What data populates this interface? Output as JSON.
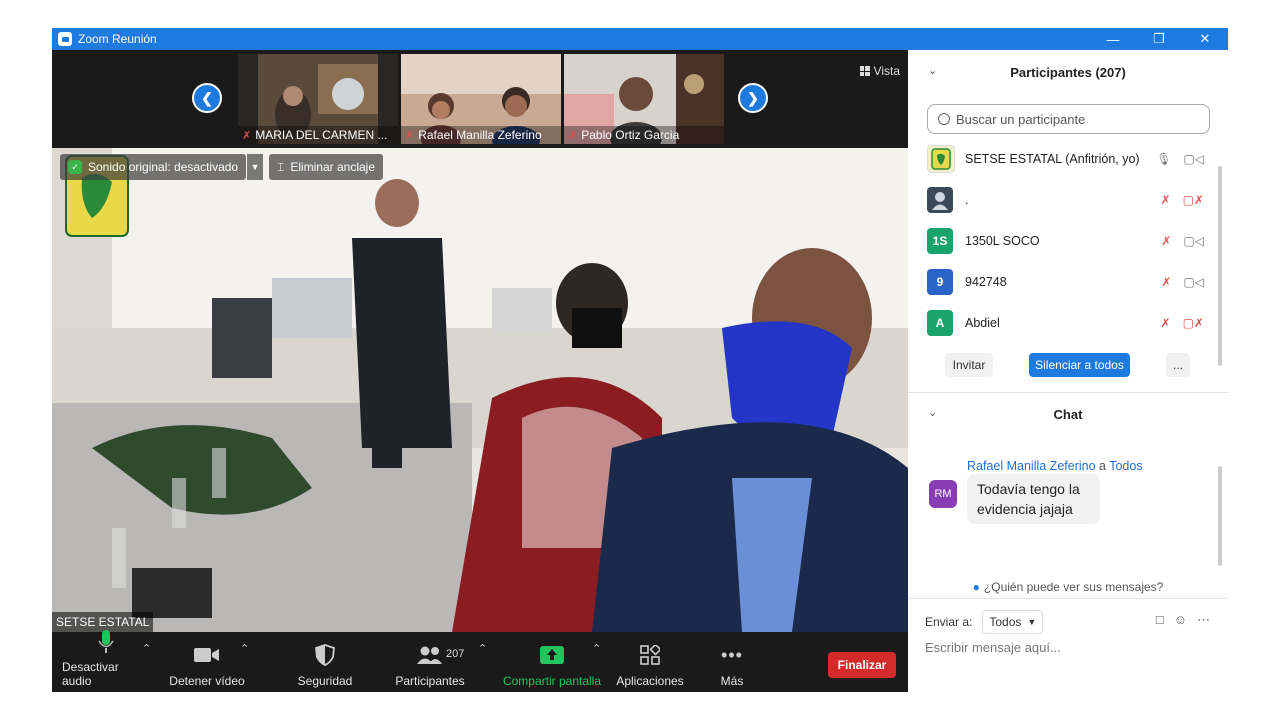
{
  "window": {
    "title": "Zoom Reunión"
  },
  "strip": {
    "thumbs": [
      {
        "name": "MARIA DEL CARMEN ..."
      },
      {
        "name": "Rafael Manilla Zeferino"
      },
      {
        "name": "Pablo Ortiz Garcia"
      }
    ],
    "vista_label": "Vista"
  },
  "main_video": {
    "original_sound": "Sonido original: desactivado",
    "unpin": "Eliminar anclaje",
    "speaker_name": "SETSE ESTATAL"
  },
  "toolbar": {
    "audio": "Desactivar audio",
    "video": "Detener vídeo",
    "security": "Seguridad",
    "participants": "Participantes",
    "participants_count": "207",
    "share": "Compartir pantalla",
    "apps": "Aplicaciones",
    "more": "Más",
    "end": "Finalizar"
  },
  "participants_panel": {
    "title": "Participantes (207)",
    "search_placeholder": "Buscar un participante",
    "items": [
      {
        "initials": "",
        "name": "SETSE ESTATAL (Anfitrión, yo)",
        "avatar_color": "#e8e8e8"
      },
      {
        "initials": "",
        "name": ".",
        "avatar_color": "#3b4a5a"
      },
      {
        "initials": "1S",
        "name": "1350L SOCO",
        "avatar_color": "#1aa36b"
      },
      {
        "initials": "9",
        "name": "942748",
        "avatar_color": "#2b63c6"
      },
      {
        "initials": "A",
        "name": "Abdiel",
        "avatar_color": "#1aa36b"
      }
    ],
    "invite": "Invitar",
    "mute_all": "Silenciar a todos",
    "more": "..."
  },
  "chat": {
    "title": "Chat",
    "message": {
      "avatar": "RM",
      "sender": "Rafael Manilla Zeferino",
      "to_word": "a",
      "recipient": "Todos",
      "text": "Todavía tengo la evidencia jajaja"
    },
    "who_can_see": "¿Quién puede ver sus mensajes?",
    "send_to_label": "Enviar a:",
    "send_to_value": "Todos",
    "input_placeholder": "Escribir mensaje aquí..."
  },
  "colors": {
    "zoom_blue": "#1f7ae0",
    "end_red": "#d42a2a",
    "share_green": "#21c45b",
    "toolbar_bg": "#1a1a1a"
  }
}
